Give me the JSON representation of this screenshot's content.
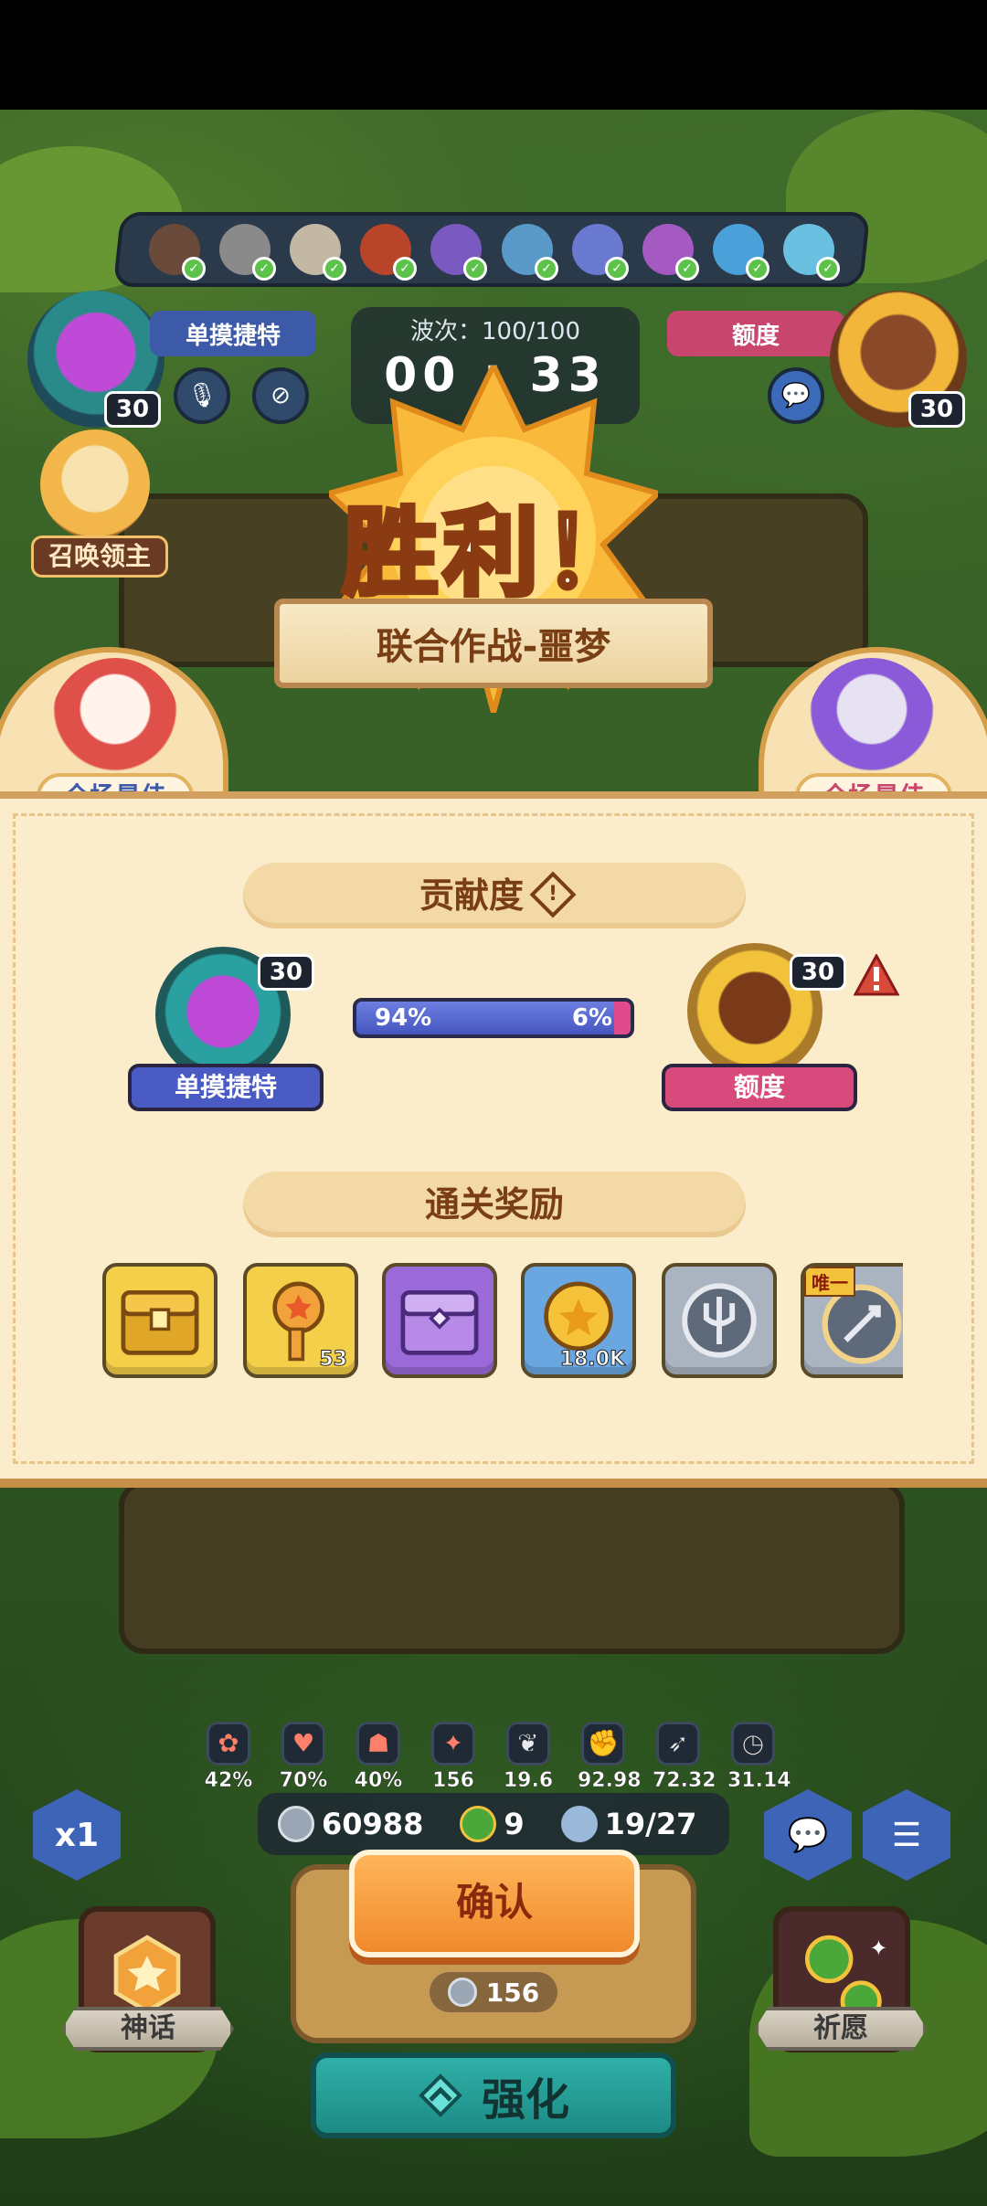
{
  "hud": {
    "left_player": {
      "name": "单摸捷特",
      "level": "30"
    },
    "right_player": {
      "name": "额度",
      "level": "30"
    },
    "wave_label": "波次：100/100",
    "timer": "00 : 33",
    "summon_lord": "召唤领主"
  },
  "result": {
    "title": "胜利！",
    "mode": "联合作战-噩梦",
    "mvp_label": "全场最佳",
    "contribution_header": "贡献度",
    "contribution": {
      "left_percent": 94,
      "right_percent": 6,
      "left_text": "94%",
      "right_text": "6%"
    },
    "players": [
      {
        "name": "单摸捷特",
        "level": "30",
        "color": "#4a5cc4"
      },
      {
        "name": "额度",
        "level": "30",
        "color": "#d94a7c"
      }
    ],
    "rewards_header": "通关奖励",
    "rewards": [
      {
        "icon": "gold-chest-icon",
        "qty": "",
        "color": "#f4cf4a"
      },
      {
        "icon": "gold-key-icon",
        "qty": "53",
        "color": "#f4cf4a"
      },
      {
        "icon": "purple-chest-icon",
        "qty": "",
        "color": "#9a6ad8"
      },
      {
        "icon": "gold-coin-icon",
        "qty": "18.0K",
        "color": "#6aa6e0"
      },
      {
        "icon": "trident-emblem-icon",
        "qty": "",
        "color": "#aab4c0"
      },
      {
        "icon": "sword-emblem-icon",
        "qty": "",
        "color": "#aab4c0",
        "tag": "唯一"
      }
    ]
  },
  "buffs": [
    {
      "icon": "rose-icon",
      "value": "42%"
    },
    {
      "icon": "heart-icon",
      "value": "70%"
    },
    {
      "icon": "hood-icon",
      "value": "40%"
    },
    {
      "icon": "crack-icon",
      "value": "156"
    },
    {
      "icon": "wing-heart-icon",
      "value": "19.6"
    },
    {
      "icon": "fist-icon",
      "value": "92.98"
    },
    {
      "icon": "arrow-icon",
      "value": "72.32"
    },
    {
      "icon": "clock-icon",
      "value": "31.14"
    }
  ],
  "resources": {
    "silver": "60988",
    "clover": "9",
    "units": "19/27"
  },
  "controls": {
    "speed": "x1",
    "confirm": "确认",
    "cost": "156",
    "myth": "神话",
    "wish": "祈愿",
    "upgrade": "强化"
  }
}
